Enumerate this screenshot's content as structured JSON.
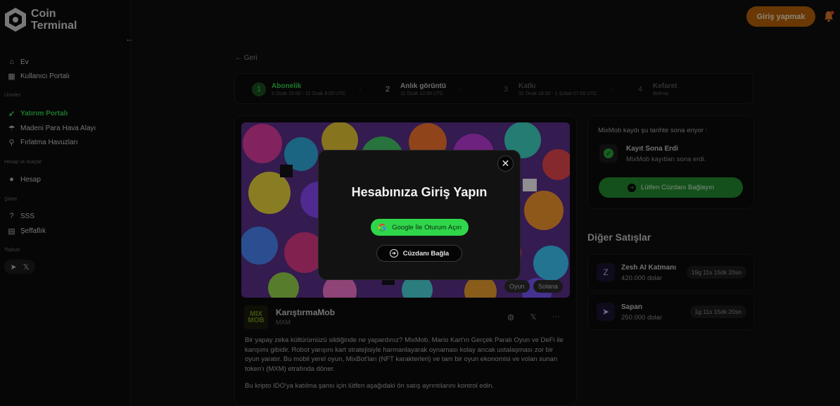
{
  "logo": {
    "line1": "Coin",
    "line2": "Terminal"
  },
  "sidebar": {
    "collapse_icon": "arrow-left-icon",
    "items_top": [
      {
        "label": "Ev",
        "icon": "home-icon"
      },
      {
        "label": "Kullanıcı Portalı",
        "icon": "grid-icon"
      }
    ],
    "section_products": "Ürünler",
    "items_products": [
      {
        "label": "Yatırım Portalı",
        "icon": "rocket-icon",
        "active": true
      },
      {
        "label": "Madeni Para Hava Alayı",
        "icon": "airdrop-icon"
      },
      {
        "label": "Fırlatma Havuzları",
        "icon": "launch-icon"
      }
    ],
    "section_account": "Hesap ve Araçlar",
    "items_account": [
      {
        "label": "Hesap",
        "icon": "user-icon"
      }
    ],
    "section_company": "Şirket",
    "items_company": [
      {
        "label": "SSS",
        "icon": "question-icon"
      },
      {
        "label": "Şeffaflık",
        "icon": "document-icon"
      }
    ],
    "section_community": "Toplum"
  },
  "header": {
    "login_label": "Giriş yapmak"
  },
  "back_label": "Geri",
  "steps": [
    {
      "num": "1",
      "title": "Abonelik",
      "date": "5 Ocak 15:00 - 11 Ocak 8:00 UTC"
    },
    {
      "num": "2",
      "title": "Anlık görüntü",
      "date": "11 Ocak 12:00 UTC"
    },
    {
      "num": "3",
      "title": "Katkı",
      "date": "31 Ocak 18:00 - 1 Şubat 07:00 UTC"
    },
    {
      "num": "4",
      "title": "Kefaret",
      "date": "Belirsiz"
    }
  ],
  "project": {
    "tags": [
      "Oyun",
      "Solana"
    ],
    "logo_text": "MIX MOB",
    "name": "KarıştırmaMob",
    "symbol": "MXM",
    "description": "Bir yapay zeka kültürümüzü sildiğinde ne yapardınız? MixMob, Mario Kart'ın Gerçek Paralı Oyun ve DeFi ile karışımı gibidir. Robot yarışını kart stratejisiyle harmanlayarak oynaması kolay ancak ustalaşması zor bir oyun yaratır. Bu mobil yerel oyun, MixBot'ları (NFT karakterleri) ve tam bir oyun ekonomisi ve volan sunan token'ı (MXM) etrafında döner.",
    "note": "Bu kripto IDO'ya katılma şansı için lütfen aşağıdaki ön satış ayrıntılarını kontrol edin."
  },
  "registration": {
    "title": "MixMob kaydı şu tarihte sona eriyor :",
    "status_title": "Kayıt Sona Erdi",
    "status_text": "MixMob kayıtları sona erdi.",
    "wallet_button": "Lütfen Cüzdanı Bağlayın"
  },
  "other_sales": {
    "title": "Diğer Satışlar",
    "items": [
      {
        "name": "Zesh AI Katmanı",
        "amount": "420.000 dolar",
        "countdown": "19g 11s 15dk 20sn"
      },
      {
        "name": "Sapan",
        "amount": "250.000 dolar",
        "countdown": "1g 11s 15dk 20sn"
      }
    ]
  },
  "modal": {
    "title": "Hesabınıza Giriş Yapın",
    "google_button": "Google İle Oturum Açın",
    "wallet_button": "Cüzdanı Bağla"
  },
  "colors": {
    "accent_green": "#2fd64a",
    "login_orange": "#b5610a"
  }
}
